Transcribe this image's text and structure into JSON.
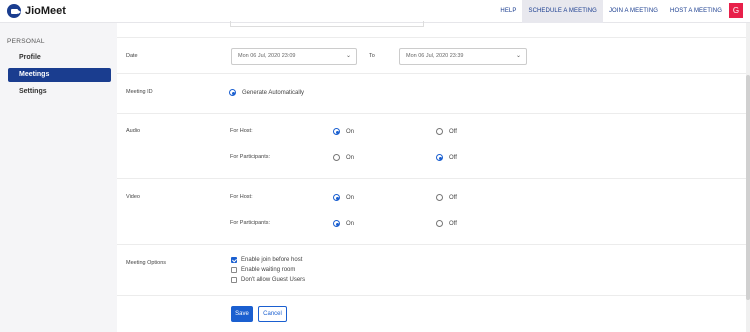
{
  "app": {
    "name": "JioMeet"
  },
  "header": {
    "nav": [
      "HELP",
      "SCHEDULE A MEETING",
      "JOIN A MEETING",
      "HOST A MEETING"
    ],
    "avatar_initial": "G"
  },
  "sidebar": {
    "section": "PERSONAL",
    "items": [
      {
        "label": "Profile"
      },
      {
        "label": "Meetings"
      },
      {
        "label": "Settings"
      }
    ]
  },
  "form": {
    "date": {
      "label": "Date",
      "start": "Mon 06 Jul, 2020 23:09",
      "to": "To",
      "end": "Mon 06 Jul, 2020 23:39"
    },
    "meeting_id": {
      "label": "Meeting ID",
      "option": "Generate Automatically"
    },
    "audio": {
      "label": "Audio",
      "host_label": "For Host:",
      "participants_label": "For Participants:",
      "on": "On",
      "off": "Off"
    },
    "video": {
      "label": "Video",
      "host_label": "For Host:",
      "participants_label": "For Participants:",
      "on": "On",
      "off": "Off"
    },
    "options": {
      "label": "Meeting Options",
      "items": [
        {
          "label": "Enable join before host",
          "checked": true
        },
        {
          "label": "Enable waiting room",
          "checked": false
        },
        {
          "label": "Don't allow Guest Users",
          "checked": false
        }
      ]
    },
    "save": "Save",
    "cancel": "Cancel"
  },
  "colors": {
    "brand": "#1a3d8f",
    "accent": "#1a5fd0",
    "avatar": "#e8204a"
  }
}
